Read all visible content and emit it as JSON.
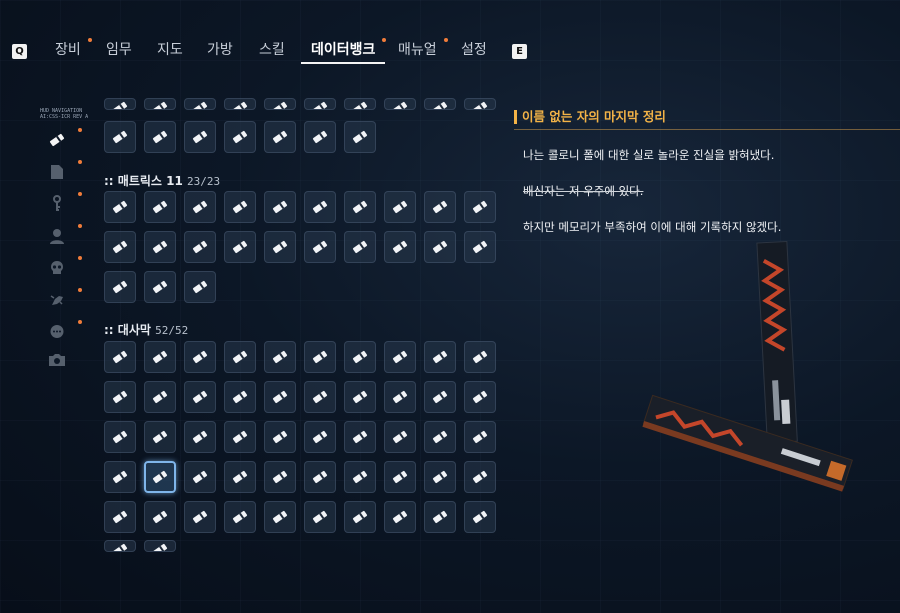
{
  "tabs": [
    {
      "label": "장비",
      "dot": true
    },
    {
      "label": "임무",
      "dot": false
    },
    {
      "label": "지도",
      "dot": false
    },
    {
      "label": "가방",
      "dot": false
    },
    {
      "label": "스킬",
      "dot": false
    },
    {
      "label": "데이터뱅크",
      "dot": true,
      "active": true
    },
    {
      "label": "매뉴얼",
      "dot": true
    },
    {
      "label": "설정",
      "dot": false
    }
  ],
  "keys": {
    "prev": "Q",
    "next": "E"
  },
  "sidebar": {
    "hud_text": "HUD NAVIGATION\nAI:CSS-ICR REV A",
    "items": [
      {
        "icon": "memory-chip-icon",
        "active": true
      },
      {
        "icon": "document-icon"
      },
      {
        "icon": "key-icon"
      },
      {
        "icon": "person-icon"
      },
      {
        "icon": "skull-icon"
      },
      {
        "icon": "creature-icon"
      },
      {
        "icon": "chat-bubble-icon"
      },
      {
        "icon": "camera-icon"
      }
    ]
  },
  "sections": [
    {
      "title": ":: 매트릭스 11",
      "count": "23/23",
      "tiles": 23
    },
    {
      "title": ":: 대사막",
      "count": "52/52",
      "tiles": 52
    }
  ],
  "entry": {
    "title": "이름 없는 자의 마지막 정리",
    "lines": [
      {
        "text": "나는 콜로니 폴에 대한 실로 놀라운 진실을 밝혀냈다.",
        "strike": false
      },
      {
        "text": "배신자는 저 우주에 있다.",
        "strike": true
      },
      {
        "text": "하지만 메모리가 부족하여 이에 대해 기록하지 않겠다.",
        "strike": false
      }
    ]
  },
  "colors": {
    "accent": "#f07c3a",
    "title": "#f3b347",
    "selected": "#7fb5ea"
  }
}
